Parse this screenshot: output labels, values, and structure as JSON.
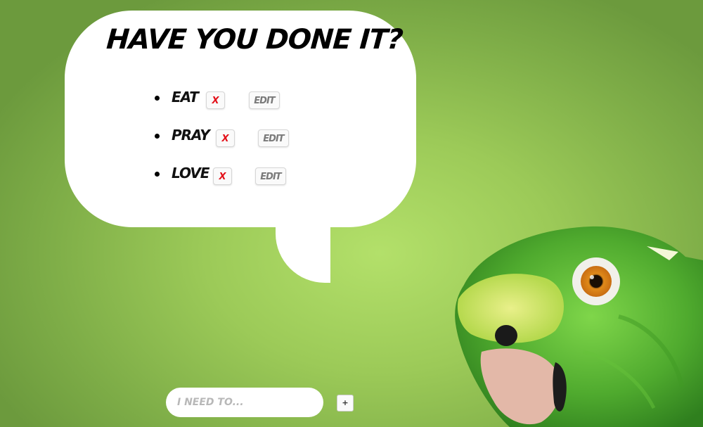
{
  "title": "HAVE YOU DONE IT?",
  "todos": [
    {
      "label": "EAT",
      "delete_label": "X",
      "edit_label": "EDIT"
    },
    {
      "label": "PRAY",
      "delete_label": "X",
      "edit_label": "EDIT"
    },
    {
      "label": "LOVE",
      "delete_label": "X",
      "edit_label": "EDIT"
    }
  ],
  "new_todo": {
    "placeholder": "I NEED TO...",
    "value": "",
    "add_label": "+"
  },
  "illustration": {
    "icon": "parrot-image"
  },
  "colors": {
    "background": "#9cca58",
    "bubble": "#ffffff",
    "delete": "#e3111a",
    "edit": "#7a7a7a"
  }
}
